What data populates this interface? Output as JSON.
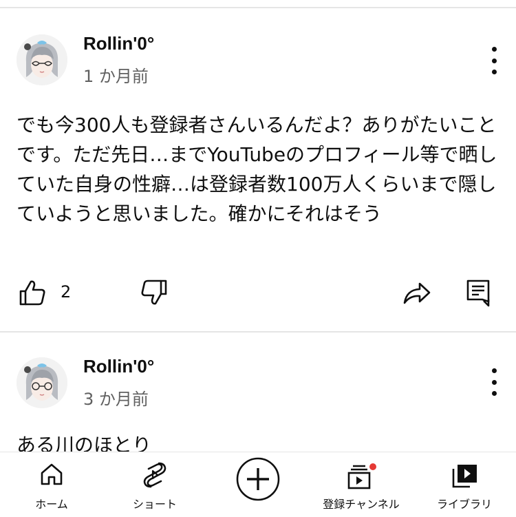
{
  "posts": [
    {
      "channel_name": "Rollin'0°",
      "time": "1 か月前",
      "text": "でも今300人も登録者さんいるんだよ？ありがたいことです。ただ先日…までYouTubeのプロフィール等で晒していた自身の性癖…は登録者数100万人くらいまで隠していようと思いました。確かにそれはそう",
      "like_count": "2"
    },
    {
      "channel_name": "Rollin'0°",
      "time": "3 か月前",
      "text": "ある川のほとり"
    }
  ],
  "bottom_nav": {
    "home": "ホーム",
    "shorts": "ショート",
    "subscriptions": "登録チャンネル",
    "library": "ライブラリ"
  },
  "icons": {
    "like": "thumbs-up-icon",
    "dislike": "thumbs-down-icon",
    "share": "share-icon",
    "reply": "comment-icon",
    "menu": "more-vertical-icon",
    "create": "plus-circle-icon"
  },
  "colors": {
    "text": "#0f0f0f",
    "secondary_text": "#606060",
    "notification_dot": "#e53935",
    "divider": "#e5e5e5"
  }
}
